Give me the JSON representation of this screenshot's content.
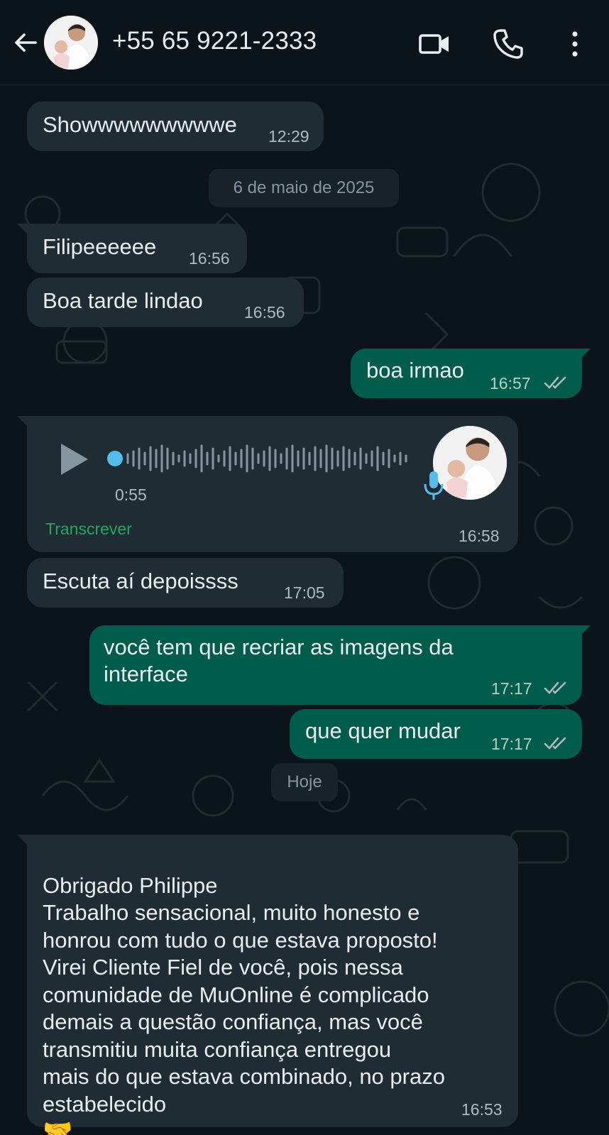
{
  "header": {
    "title": "+55 65 9221-2333",
    "back_icon": "arrow-left-icon",
    "video_icon": "video-call-icon",
    "call_icon": "phone-icon",
    "menu_icon": "more-vert-icon"
  },
  "colors": {
    "background": "#0b141a",
    "incoming_bubble": "#202c33",
    "outgoing_bubble": "#005c4b",
    "tick_read": "#aebac1",
    "transcribe_link": "#25a55f",
    "voice_dot": "#53bdeb"
  },
  "dates": {
    "d1": "6 de maio de 2025",
    "d2": "Hoje"
  },
  "messages": {
    "m1": {
      "text": "Showwwwwwwwwe",
      "time": "12:29"
    },
    "m2": {
      "text": "Filipeeeeee",
      "time": "16:56"
    },
    "m3": {
      "text": "Boa tarde lindao",
      "time": "16:56"
    },
    "m4": {
      "text": "boa irmao",
      "time": "16:57"
    },
    "voice": {
      "duration": "0:55",
      "transcribe": "Transcrever",
      "time": "16:58"
    },
    "m5": {
      "text": "Escuta aí depoissss",
      "time": "17:05"
    },
    "m6": {
      "text": "você tem que recriar as imagens da\ninterface",
      "time": "17:17"
    },
    "m7": {
      "text": "que quer mudar",
      "time": "17:17"
    },
    "m8": {
      "text": "Obrigado Philippe\nTrabalho sensacional, muito honesto e\nhonrou com tudo o que estava proposto!\nVirei Cliente Fiel de você, pois nessa\ncomunidade de MuOnline é complicado\ndemais a questão confiança, mas você\ntransmitiu muita confiança entregou\nmais do que estava combinado, no prazo\nestabelecido",
      "emoji": "🤝",
      "time": "16:53"
    }
  }
}
